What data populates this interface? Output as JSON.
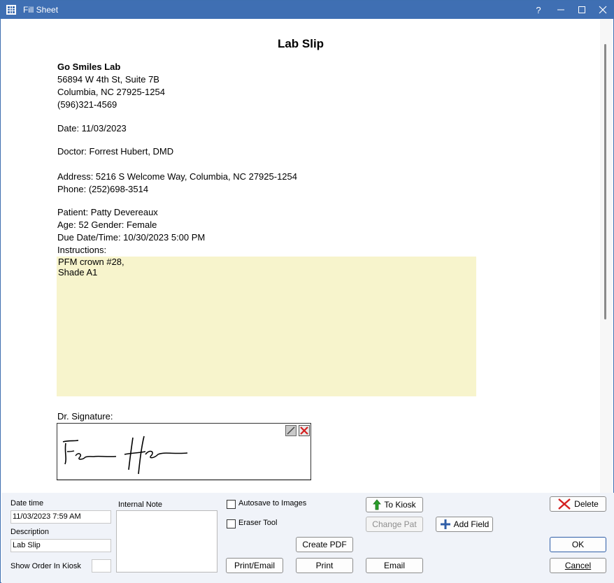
{
  "window": {
    "title": "Fill Sheet",
    "help": "?",
    "minimize": "—",
    "maximize": "☐",
    "close": "✕"
  },
  "sheet": {
    "title": "Lab Slip",
    "lab": {
      "name": "Go Smiles Lab",
      "address1": "56894 W 4th St, Suite 7B",
      "address2": "Columbia, NC 27925-1254",
      "phone": "(596)321-4569"
    },
    "date": "Date: 11/03/2023",
    "doctor": "Doctor:  Forrest Hubert, DMD",
    "address": "Address: 5216 S Welcome Way, Columbia, NC  27925-1254",
    "phone": "Phone: (252)698-3514",
    "patient": "Patient: Patty Devereaux",
    "age_gender": "Age: 52 Gender: Female",
    "due": "Due Date/Time:    10/30/2023  5:00 PM",
    "instructions_label": "Instructions:",
    "instructions_lines": [
      "PFM crown #28,",
      "Shade A1"
    ],
    "signature_label": "Dr. Signature:"
  },
  "bottom": {
    "date_time_label": "Date time",
    "date_time_value": "11/03/2023 7:59 AM",
    "description_label": "Description",
    "description_value": "Lab Slip",
    "show_order_label": "Show Order In Kiosk",
    "show_order_value": "",
    "internal_note_label": "Internal Note",
    "internal_note_value": "",
    "autosave_label": "Autosave to Images",
    "eraser_label": "Eraser Tool",
    "buttons": {
      "to_kiosk": "To Kiosk",
      "change_pat": "Change Pat",
      "add_field": "Add Field",
      "create_pdf": "Create PDF",
      "print_email": "Print/Email",
      "print": "Print",
      "email": "Email",
      "delete": "Delete",
      "ok": "OK",
      "cancel": "Cancel"
    }
  },
  "colors": {
    "titlebar": "#3f6fb3",
    "instructions_bg": "#f7f4cc",
    "panel_bg": "#f0f3f9",
    "delete_x": "#d42020",
    "kiosk_arrow": "#2aa02a",
    "add_plus": "#2f5ea8"
  }
}
